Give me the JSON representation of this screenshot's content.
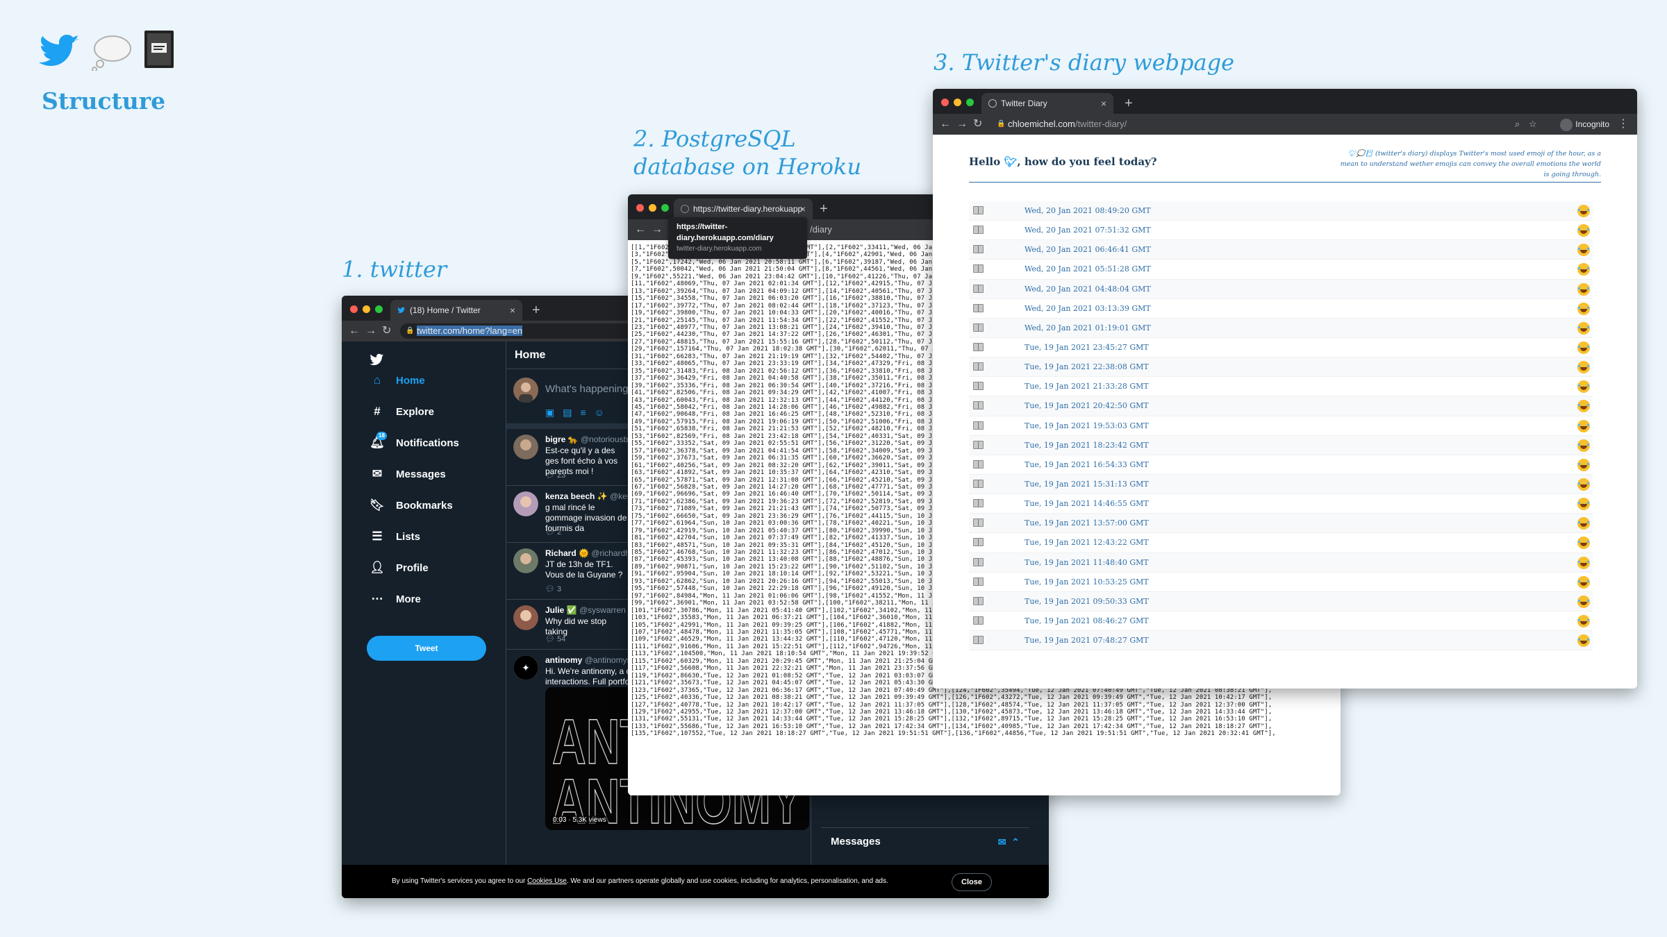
{
  "header": {
    "title": "Structure",
    "icons": [
      "twitter-bird-icon",
      "thought-bubble-icon",
      "diary-book-icon"
    ]
  },
  "labels": {
    "twitter": "1. twitter",
    "postgres_line1": "2. PostgreSQL",
    "postgres_line2": "database on Heroku",
    "diary": "3. Twitter's diary webpage"
  },
  "twitter_window": {
    "tab_title": "(18) Home / Twitter",
    "url": "twitter.com/home?lang=en",
    "nav": [
      {
        "label": "Home",
        "icon": "home-icon",
        "active": true
      },
      {
        "label": "Explore",
        "icon": "hashtag-icon"
      },
      {
        "label": "Notifications",
        "icon": "bell-icon",
        "badge": "18"
      },
      {
        "label": "Messages",
        "icon": "envelope-icon"
      },
      {
        "label": "Bookmarks",
        "icon": "bookmark-icon"
      },
      {
        "label": "Lists",
        "icon": "list-icon"
      },
      {
        "label": "Profile",
        "icon": "person-icon"
      },
      {
        "label": "More",
        "icon": "more-icon"
      }
    ],
    "tweet_button": "Tweet",
    "feed_title": "Home",
    "compose_placeholder": "What's happening",
    "posts": [
      {
        "name": "bigre 🐆",
        "handle": "@notoriousb",
        "text": "Est-ce qu'il y a des ges font écho à vos parents moi !",
        "stat": "23"
      },
      {
        "name": "kenza beech ✨",
        "handle": "@ker",
        "text": "g mal rincé le gommage invasion de fourmis da",
        "stat": "2"
      },
      {
        "name": "Richard 🌞",
        "handle": "@richardh",
        "text": "JT de 13h de TF1. Vous de la Guyane ?",
        "stat": "3"
      },
      {
        "name": "Julie ✅",
        "handle": "@syswarren",
        "text": "Why did we stop taking",
        "stat": "54"
      },
      {
        "name": "antinomy",
        "handle": "@antinomys",
        "text": "Hi. We're antinomy, a c interactions. Full portfo",
        "stat": ""
      }
    ],
    "media_views": "0:03 · 5.3K views",
    "media_word": "ANTINOMY",
    "messages_label": "Messages",
    "cookie_text_pre": "By using Twitter's services you agree to our ",
    "cookie_link": "Cookies Use",
    "cookie_text_post": ". We and our partners operate globally and use cookies, including for analytics, personalisation, and ads.",
    "close_button": "Close"
  },
  "postgres_window": {
    "tab_title": "https://twitter-diary.herokuapp",
    "url_suffix": "/diary",
    "tooltip_url": "https://twitter-diary.herokuapp.com/diary",
    "tooltip_host": "twitter-diary.herokuapp.com",
    "lines": [
      "[[1,\"1F602\",27890,\"Wed, 06 Jan 2021 19:40:58 GMT\"],[2,\"1F602\",33411,\"Wed, 06 Jan 2021 20:06:36",
      "[3,\"1F602\",35662,\"Wed, 06 Jan 2021 20:33:20 GMT\"],[4,\"1F602\",42901,\"Wed, 06 Jan 2021 20:42:1",
      "[5,\"1F602\",17242,\"Wed, 06 Jan 2021 20:58:11 GMT\"],[6,\"1F602\",39187,\"Wed, 06 Jan 2021 21:01:4",
      "[7,\"1F602\",50042,\"Wed, 06 Jan 2021 21:50:04 GMT\"],[8,\"1F602\",44561,\"Wed, 06 Jan 2021 22:01:3",
      "[9,\"1F602\",55221,\"Wed, 06 Jan 2021 23:04:42 GMT\"],[10,\"1F602\",41226,\"Thu, 07 Jan 2021 00:01:3",
      "[11,\"1F602\",48069,\"Thu, 07 Jan 2021 02:01:34 GMT\"],[12,\"1F602\",42915,\"Thu, 07 Jan 2021 03:02:",
      "[13,\"1F602\",39264,\"Thu, 07 Jan 2021 04:09:12 GMT\"],[14,\"1F602\",40561,\"Thu, 07 Jan 2021 05:09:",
      "[15,\"1F602\",34558,\"Thu, 07 Jan 2021 06:03:20 GMT\"],[16,\"1F602\",38810,\"Thu, 07 Jan 2021 07:03:",
      "[17,\"1F602\",39772,\"Thu, 07 Jan 2021 08:02:44 GMT\"],[18,\"1F602\",37123,\"Thu, 07 Jan 2021 09:04:",
      "[19,\"1F602\",39800,\"Thu, 07 Jan 2021 10:04:33 GMT\"],[20,\"1F602\",40016,\"Thu, 07 Jan 2021 11:00:",
      "[21,\"1F602\",25145,\"Thu, 07 Jan 2021 11:54:34 GMT\"],[22,\"1F602\",41552,\"Thu, 07 Jan 2021 12:25:",
      "[23,\"1F602\",48977,\"Thu, 07 Jan 2021 13:08:21 GMT\"],[24,\"1F602\",39410,\"Thu, 07 Jan 2021 14:00:",
      "[25,\"1F602\",44230,\"Thu, 07 Jan 2021 14:37:22 GMT\"],[26,\"1F602\",46301,\"Thu, 07 Jan 2021 15:19:",
      "[27,\"1F602\",48815,\"Thu, 07 Jan 2021 15:55:16 GMT\"],[28,\"1F602\",50112,\"Thu, 07 Jan 2021 16:39:",
      "[29,\"1F602\",157164,\"Thu, 07 Jan 2021 18:02:38 GMT\"],[30,\"1F602\",62011,\"Thu, 07 Jan 2021 20:23",
      "[31,\"1F602\",66283,\"Thu, 07 Jan 2021 21:19:19 GMT\"],[32,\"1F602\",54402,\"Thu, 07 Jan 2021 22:27:",
      "[33,\"1F602\",48065,\"Thu, 07 Jan 2021 23:33:19 GMT\"],[34,\"1F602\",47329,\"Fri, 08 Jan 2021 01:04:",
      "[35,\"1F602\",31483,\"Fri, 08 Jan 2021 02:56:12 GMT\"],[36,\"1F602\",33810,\"Fri, 08 Jan 2021 03:43:",
      "[37,\"1F602\",36429,\"Fri, 08 Jan 2021 04:40:58 GMT\"],[38,\"1F602\",35011,\"Fri, 08 Jan 2021 05:38:",
      "[39,\"1F602\",35336,\"Fri, 08 Jan 2021 06:30:54 GMT\"],[40,\"1F602\",37216,\"Fri, 08 Jan 2021 07:34:",
      "[41,\"1F602\",82506,\"Fri, 08 Jan 2021 09:34:29 GMT\"],[42,\"1F602\",41007,\"Fri, 08 Jan 2021 11:31:",
      "[43,\"1F602\",60043,\"Fri, 08 Jan 2021 12:32:13 GMT\"],[44,\"1F602\",44120,\"Fri, 08 Jan 2021 13:38:",
      "[45,\"1F602\",58042,\"Fri, 08 Jan 2021 14:28:06 GMT\"],[46,\"1F602\",49882,\"Fri, 08 Jan 2021 15:22:",
      "[47,\"1F602\",90648,\"Fri, 08 Jan 2021 16:46:25 GMT\"],[48,\"1F602\",52310,\"Fri, 08 Jan 2021 18:05:",
      "[49,\"1F602\",57915,\"Fri, 08 Jan 2021 19:06:19 GMT\"],[50,\"1F602\",51006,\"Fri, 08 Jan 2021 20:25:",
      "[51,\"1F602\",65838,\"Fri, 08 Jan 2021 21:21:53 GMT\"],[52,\"1F602\",48210,\"Fri, 08 Jan 2021 22:29:",
      "[53,\"1F602\",82569,\"Fri, 08 Jan 2021 23:42:18 GMT\"],[54,\"1F602\",40331,\"Sat, 09 Jan 2021 01:04:",
      "[55,\"1F602\",33352,\"Sat, 09 Jan 2021 02:55:51 GMT\"],[56,\"1F602\",31220,\"Sat, 09 Jan 2021 04:28:",
      "[57,\"1F602\",36378,\"Sat, 09 Jan 2021 04:41:54 GMT\"],[58,\"1F602\",34009,\"Sat, 09 Jan 2021 05:39:",
      "[59,\"1F602\",37673,\"Sat, 09 Jan 2021 06:31:35 GMT\"],[60,\"1F602\",36620,\"Sat, 09 Jan 2021 07:35:",
      "[61,\"1F602\",40256,\"Sat, 09 Jan 2021 08:32:20 GMT\"],[62,\"1F602\",39011,\"Sat, 09 Jan 2021 09:34:",
      "[63,\"1F602\",41892,\"Sat, 09 Jan 2021 10:35:37 GMT\"],[64,\"1F602\",42310,\"Sat, 09 Jan 2021 11:31:",
      "[65,\"1F602\",57871,\"Sat, 09 Jan 2021 12:31:08 GMT\"],[66,\"1F602\",45210,\"Sat, 09 Jan 2021 13:38:",
      "[67,\"1F602\",56828,\"Sat, 09 Jan 2021 14:27:20 GMT\"],[68,\"1F602\",47771,\"Sat, 09 Jan 2021 15:22:",
      "[69,\"1F602\",96696,\"Sat, 09 Jan 2021 16:46:40 GMT\"],[70,\"1F602\",50114,\"Sat, 09 Jan 2021 18:08:",
      "[71,\"1F602\",62386,\"Sat, 09 Jan 2021 19:36:23 GMT\"],[72,\"1F602\",52819,\"Sat, 09 Jan 2021 20:27:",
      "[73,\"1F602\",71089,\"Sat, 09 Jan 2021 21:21:43 GMT\"],[74,\"1F602\",50773,\"Sat, 09 Jan 2021 22:30:",
      "[75,\"1F602\",66650,\"Sat, 09 Jan 2021 23:36:29 GMT\"],[76,\"1F602\",44115,\"Sun, 10 Jan 2021 01:07:",
      "[77,\"1F602\",61964,\"Sun, 10 Jan 2021 03:00:36 GMT\"],[78,\"1F602\",40221,\"Sun, 10 Jan 2021 04:44:",
      "[79,\"1F602\",42919,\"Sun, 10 Jan 2021 05:40:37 GMT\"],[80,\"1F602\",39990,\"Sun, 10 Jan 2021 06:33:",
      "[81,\"1F602\",42704,\"Sun, 10 Jan 2021 07:37:49 GMT\"],[82,\"1F602\",41337,\"Sun, 10 Jan 2021 08:33:",
      "[83,\"1F602\",48571,\"Sun, 10 Jan 2021 09:35:31 GMT\"],[84,\"1F602\",45120,\"Sun, 10 Jan 2021 10:37:",
      "[85,\"1F602\",46768,\"Sun, 10 Jan 2021 11:32:23 GMT\"],[86,\"1F602\",47012,\"Sun, 10 Jan 2021 12:32:",
      "[87,\"1F602\",45393,\"Sun, 10 Jan 2021 13:40:08 GMT\"],[88,\"1F602\",48876,\"Sun, 10 Jan 2021 14:28:",
      "[89,\"1F602\",90871,\"Sun, 10 Jan 2021 15:23:22 GMT\"],[90,\"1F602\",51102,\"Sun, 10 Jan 2021 16:47:",
      "[91,\"1F602\",95904,\"Sun, 10 Jan 2021 18:10:14 GMT\"],[92,\"1F602\",53221,\"Sun, 10 Jan 2021 19:36:",
      "[93,\"1F602\",62862,\"Sun, 10 Jan 2021 20:26:16 GMT\"],[94,\"1F602\",55013,\"Sun, 10 Jan 2021 21:22:",
      "[95,\"1F602\",57448,\"Sun, 10 Jan 2021 22:29:18 GMT\"],[96,\"1F602\",49120,\"Sun, 10 Jan 2021 23:36:",
      "[97,\"1F602\",84984,\"Mon, 11 Jan 2021 01:06:06 GMT\"],[98,\"1F602\",41552,\"Mon, 11 Jan 2021 02:58:",
      "[99,\"1F602\",36901,\"Mon, 11 Jan 2021 03:52:58 GMT\"],[100,\"1F602\",38211,\"Mon, 11 Jan 2021 04:44:",
      "[101,\"1F602\",30786,\"Mon, 11 Jan 2021 05:41:40 GMT\"],[102,\"1F602\",34102,\"Mon, 11 Jan 2021 06:35",
      "[103,\"1F602\",35583,\"Mon, 11 Jan 2021 06:37:21 GMT\"],[104,\"1F602\",36010,\"Mon, 11 Jan 2021 08:31",
      "[105,\"1F602\",42991,\"Mon, 11 Jan 2021 09:39:25 GMT\"],[106,\"1F602\",41882,\"Mon, 11 Jan 2021 10:41",
      "[107,\"1F602\",48478,\"Mon, 11 Jan 2021 11:35:05 GMT\"],[108,\"1F602\",45771,\"Mon, 11 Jan 2021 12:38",
      "[109,\"1F602\",46529,\"Mon, 11 Jan 2021 13:44:32 GMT\"],[110,\"1F602\",47120,\"Mon, 11 Jan 2021 14:31",
      "[111,\"1F602\",91606,\"Mon, 11 Jan 2021 15:22:51 GMT\"],[112,\"1F602\",94726,\"Mon, 11 Jan 2021 16:46:21 GMT\"],[113,\"1F602\",50718,\"Mon, 11 Jan 2021 18:10:54 GMT\"],",
      "[113,\"1F602\",104500,\"Mon, 11 Jan 2021 18:10:54 GMT\",\"Mon, 11 Jan 2021 19:39:52 GMT\"],[114,\"1F602\",56943,\"Mon, 11 Jan 2021 19:39:52 GMT\",\"Mon, 11 Jan 2021 20:29:45 GMT\"],",
      "[115,\"1F602\",60329,\"Mon, 11 Jan 2021 20:29:45 GMT\",\"Mon, 11 Jan 2021 21:25:04 GMT\"],[116,\"1F602\",67182,\"Mon, 11 Jan 2021 21:25:04 GMT\",\"Mon, 11 Jan 2021 22:32:21 GMT\"],",
      "[117,\"1F602\",56608,\"Mon, 11 Jan 2021 22:32:21 GMT\",\"Mon, 11 Jan 2021 23:37:56 GMT\"],[118,\"1F602\",67690,\"Mon, 11 Jan 2021 23:37:56 GMT\",\"Tue, 12 Jan 2021 01:08:52 GMT\"],",
      "[119,\"1F602\",86630,\"Tue, 12 Jan 2021 01:08:52 GMT\",\"Tue, 12 Jan 2021 03:03:07 GMT\"],[120,\"1F602\",60766,\"Tue, 12 Jan 2021 03:03:07 GMT\",\"Tue, 12 Jan 2021 04:45:07 GMT\"],",
      "[121,\"1F602\",35673,\"Tue, 12 Jan 2021 04:45:07 GMT\",\"Tue, 12 Jan 2021 05:43:30 GMT\"],[122,\"1F602\",30140,\"Tue, 12 Jan 2021 05:43:30 GMT\",\"Tue, 12 Jan 2021 06:36:17 GMT\"],",
      "[123,\"1F602\",37365,\"Tue, 12 Jan 2021 06:36:17 GMT\",\"Tue, 12 Jan 2021 07:40:49 GMT\"],[124,\"1F602\",35494,\"Tue, 12 Jan 2021 07:40:49 GMT\",\"Tue, 12 Jan 2021 08:38:21 GMT\"],",
      "[125,\"1F602\",40336,\"Tue, 12 Jan 2021 08:38:21 GMT\",\"Tue, 12 Jan 2021 09:39:49 GMT\"],[126,\"1F602\",43272,\"Tue, 12 Jan 2021 09:39:49 GMT\",\"Tue, 12 Jan 2021 10:42:17 GMT\"],",
      "[127,\"1F602\",40778,\"Tue, 12 Jan 2021 10:42:17 GMT\",\"Tue, 12 Jan 2021 11:37:05 GMT\"],[128,\"1F602\",48574,\"Tue, 12 Jan 2021 11:37:05 GMT\",\"Tue, 12 Jan 2021 12:37:00 GMT\"],",
      "[129,\"1F602\",42955,\"Tue, 12 Jan 2021 12:37:00 GMT\",\"Tue, 12 Jan 2021 13:46:18 GMT\"],[130,\"1F602\",45873,\"Tue, 12 Jan 2021 13:46:18 GMT\",\"Tue, 12 Jan 2021 14:33:44 GMT\"],",
      "[131,\"1F602\",55131,\"Tue, 12 Jan 2021 14:33:44 GMT\",\"Tue, 12 Jan 2021 15:28:25 GMT\"],[132,\"1F602\",89715,\"Tue, 12 Jan 2021 15:28:25 GMT\",\"Tue, 12 Jan 2021 16:53:10 GMT\"],",
      "[133,\"1F602\",55686,\"Tue, 12 Jan 2021 16:53:10 GMT\",\"Tue, 12 Jan 2021 17:42:34 GMT\"],[134,\"1F602\",40985,\"Tue, 12 Jan 2021 17:42:34 GMT\",\"Tue, 12 Jan 2021 18:18:27 GMT\"],",
      "[135,\"1F602\",107552,\"Tue, 12 Jan 2021 18:18:27 GMT\",\"Tue, 12 Jan 2021 19:51:51 GMT\"],[136,\"1F602\",44856,\"Tue, 12 Jan 2021 19:51:51 GMT\",\"Tue, 12 Jan 2021 20:32:41 GMT\"],"
    ]
  },
  "diary_window": {
    "tab_title": "Twitter Diary",
    "url_host": "chloemichel.com",
    "url_path": "/twitter-diary/",
    "incognito": "Incognito",
    "hello_pre": "Hello ",
    "hello_post": ", how do you feel today?",
    "description": "(twitter's diary) displays Twitter's most used emoji of the hour, as a mean to understand wether emojis can convey the overall emotions the world is going through.",
    "rows": [
      "Wed, 20 Jan 2021 08:49:20 GMT",
      "Wed, 20 Jan 2021 07:51:32 GMT",
      "Wed, 20 Jan 2021 06:46:41 GMT",
      "Wed, 20 Jan 2021 05:51:28 GMT",
      "Wed, 20 Jan 2021 04:48:04 GMT",
      "Wed, 20 Jan 2021 03:13:39 GMT",
      "Wed, 20 Jan 2021 01:19:01 GMT",
      "Tue, 19 Jan 2021 23:45:27 GMT",
      "Tue, 19 Jan 2021 22:38:08 GMT",
      "Tue, 19 Jan 2021 21:33:28 GMT",
      "Tue, 19 Jan 2021 20:42:50 GMT",
      "Tue, 19 Jan 2021 19:53:03 GMT",
      "Tue, 19 Jan 2021 18:23:42 GMT",
      "Tue, 19 Jan 2021 16:54:33 GMT",
      "Tue, 19 Jan 2021 15:31:13 GMT",
      "Tue, 19 Jan 2021 14:46:55 GMT",
      "Tue, 19 Jan 2021 13:57:00 GMT",
      "Tue, 19 Jan 2021 12:43:22 GMT",
      "Tue, 19 Jan 2021 11:48:40 GMT",
      "Tue, 19 Jan 2021 10:53:25 GMT",
      "Tue, 19 Jan 2021 09:50:33 GMT",
      "Tue, 19 Jan 2021 08:46:27 GMT",
      "Tue, 19 Jan 2021 07:48:27 GMT"
    ],
    "row_emoji": "face-with-tears-of-joy-icon"
  },
  "colors": {
    "accent": "#2f9bd8",
    "twitter_blue": "#1da1f2",
    "twitter_bg": "#15202b",
    "page_bg": "#ebf5fb"
  }
}
